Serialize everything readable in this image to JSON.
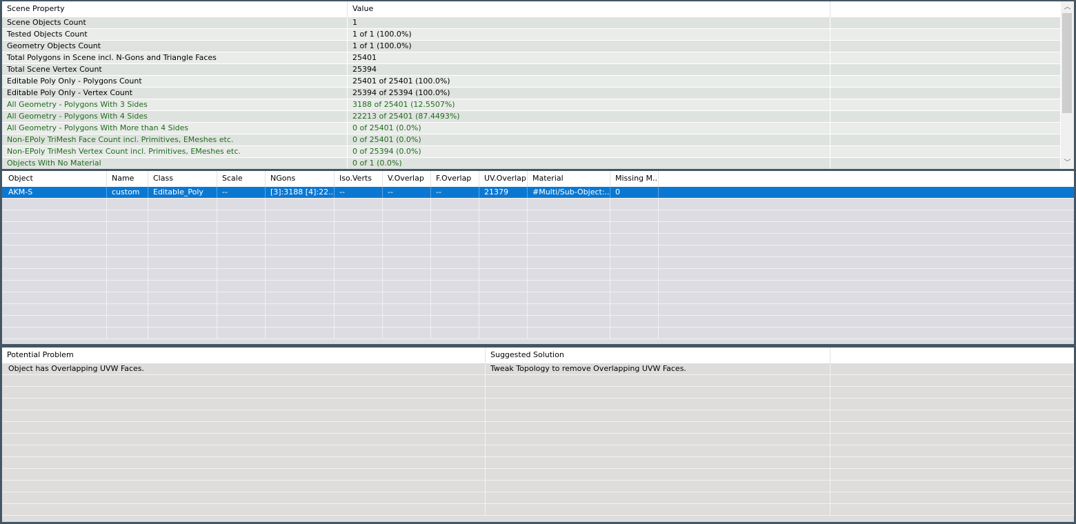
{
  "scene_table": {
    "headers": [
      "Scene Property",
      "Value"
    ],
    "rows": [
      {
        "property": "Scene Objects Count",
        "value": "1",
        "highlight": false
      },
      {
        "property": "Tested Objects Count",
        "value": "1 of 1 (100.0%)",
        "highlight": false
      },
      {
        "property": "Geometry Objects Count",
        "value": "1 of 1 (100.0%)",
        "highlight": false
      },
      {
        "property": "Total Polygons in Scene incl. N-Gons and Triangle Faces",
        "value": "25401",
        "highlight": false
      },
      {
        "property": "Total Scene Vertex Count",
        "value": "25394",
        "highlight": false
      },
      {
        "property": "Editable Poly Only - Polygons Count",
        "value": "25401 of 25401 (100.0%)",
        "highlight": false
      },
      {
        "property": "Editable Poly Only - Vertex Count",
        "value": "25394 of 25394 (100.0%)",
        "highlight": false
      },
      {
        "property": "All Geometry - Polygons With 3 Sides",
        "value": "3188 of 25401 (12.5507%)",
        "highlight": true
      },
      {
        "property": "All Geometry - Polygons With 4 Sides",
        "value": "22213 of 25401 (87.4493%)",
        "highlight": true
      },
      {
        "property": "All Geometry - Polygons With More than 4 Sides",
        "value": "0 of 25401 (0.0%)",
        "highlight": true
      },
      {
        "property": "Non-EPoly TriMesh Face Count incl. Primitives, EMeshes etc.",
        "value": "0 of 25401 (0.0%)",
        "highlight": true
      },
      {
        "property": "Non-EPoly TriMesh Vertex Count incl. Primitives, EMeshes etc.",
        "value": "0 of 25394 (0.0%)",
        "highlight": true
      },
      {
        "property": "Objects With No Material",
        "value": "0 of 1 (0.0%)",
        "highlight": true
      }
    ],
    "scrollbar": {
      "up_icon": "chevron-up-icon",
      "down_icon": "chevron-down-icon",
      "up_glyph": "︿",
      "down_glyph": "﹀"
    }
  },
  "object_table": {
    "headers": [
      "Object",
      "Name",
      "Class",
      "Scale",
      "NGons",
      "Iso.Verts",
      "V.Overlap",
      "F.Overlap",
      "UV.Overlap",
      "Material",
      "Missing M..."
    ],
    "rows": [
      {
        "selected": true,
        "cells": [
          "AKM-S",
          "custom",
          "Editable_Poly",
          "--",
          "[3]:3188 [4]:22...",
          "--",
          "--",
          "--",
          "21379",
          "#Multi/Sub-Object:...",
          "0"
        ]
      }
    ],
    "selection_color": "#0a78d2"
  },
  "problem_table": {
    "headers": [
      "Potential Problem",
      "Suggested Solution"
    ],
    "rows": [
      {
        "cells": [
          "Object has Overlapping UVW Faces.",
          "Tweak Topology to remove Overlapping UVW Faces."
        ]
      }
    ]
  },
  "colors": {
    "highlight_text": "#1f6b1f",
    "window_border": "#445563"
  }
}
